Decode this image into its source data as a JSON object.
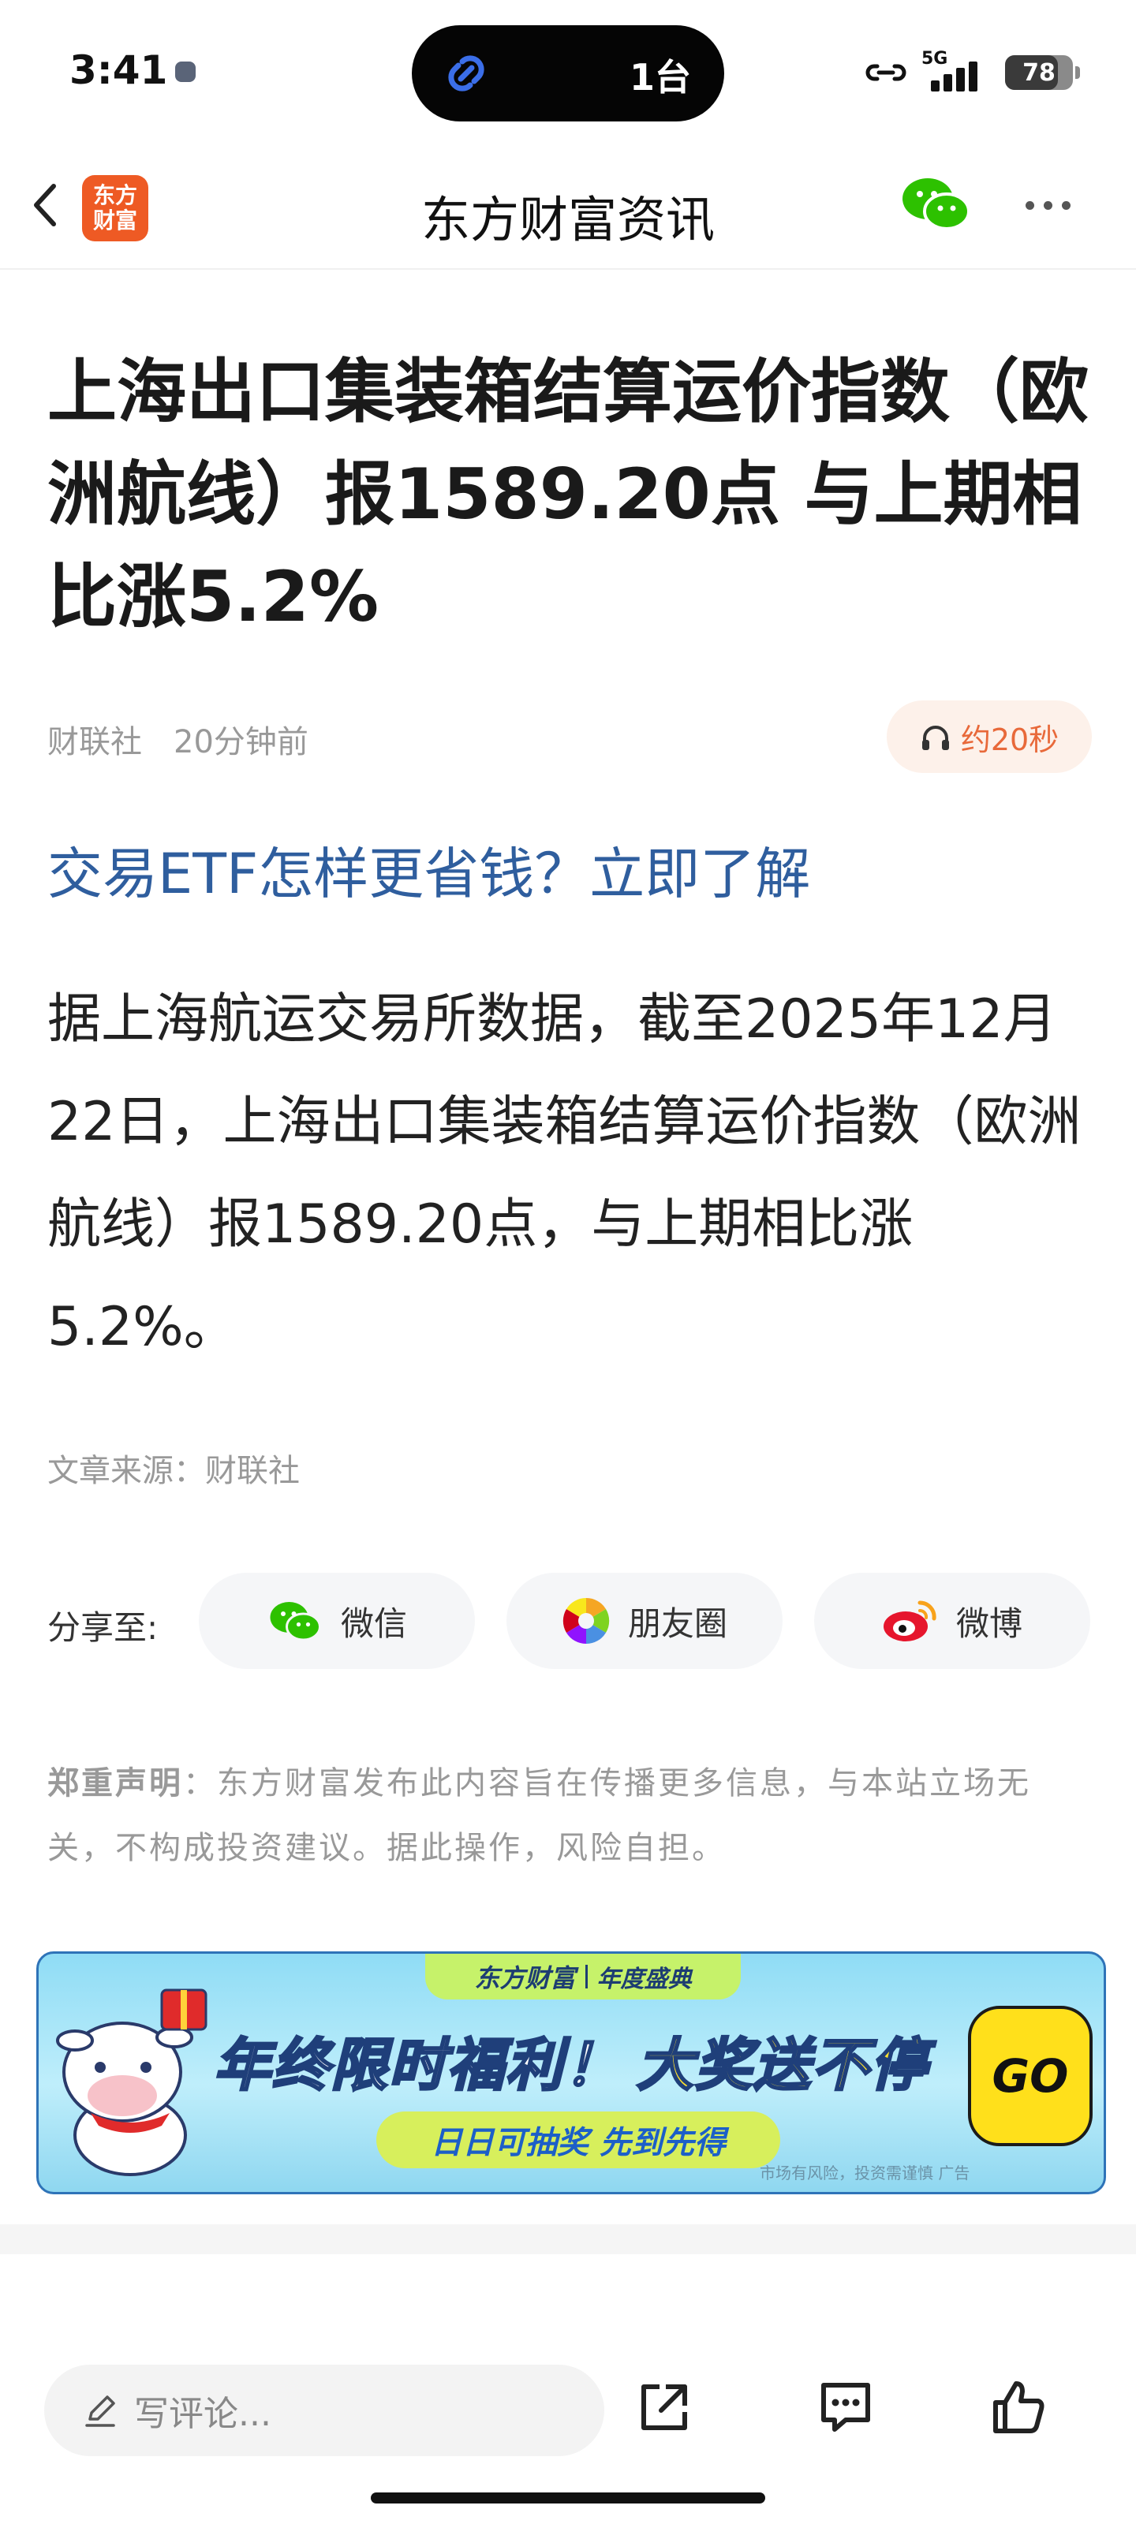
{
  "status_bar": {
    "time": "3:41",
    "island_text": "1台",
    "network": "5G",
    "battery": "78",
    "battery_level": 0.78
  },
  "nav": {
    "logo_line1": "东方",
    "logo_line2": "财富",
    "title": "东方财富资讯"
  },
  "article": {
    "title": "上海出口集装箱结算运价指数（欧洲航线）报1589.20点 与上期相比涨5.2%",
    "source_name": "财联社",
    "time_ago": "20分钟前",
    "listen_label": "约20秒",
    "promo_link": "交易ETF怎样更省钱？立即了解",
    "body": "据上海航运交易所数据，截至2025年12月22日，上海出口集装箱结算运价指数（欧洲航线）报1589.20点，与上期相比涨5.2%。",
    "source_line": "文章来源：财联社"
  },
  "share": {
    "label": "分享至:",
    "wechat": "微信",
    "moments": "朋友圈",
    "weibo": "微博"
  },
  "disclaimer": {
    "heading": "郑重声明",
    "text": "：东方财富发布此内容旨在传播更多信息，与本站立场无关，不构成投资建议。据此操作，风险自担。"
  },
  "banner": {
    "brand": "东方财富",
    "subtitle": "年度盛典",
    "main_a": "年终限时福利！",
    "main_b": "大奖送不停",
    "pill": "日日可抽奖 先到先得",
    "go": "GO",
    "risk": "市场有风险，投资需谨慎 广告"
  },
  "bottom_bar": {
    "comment_placeholder": "写评论..."
  },
  "colors": {
    "link": "#2f5e9e",
    "accent_orange": "#e8693a",
    "logo_orange": "#ee5a24"
  }
}
